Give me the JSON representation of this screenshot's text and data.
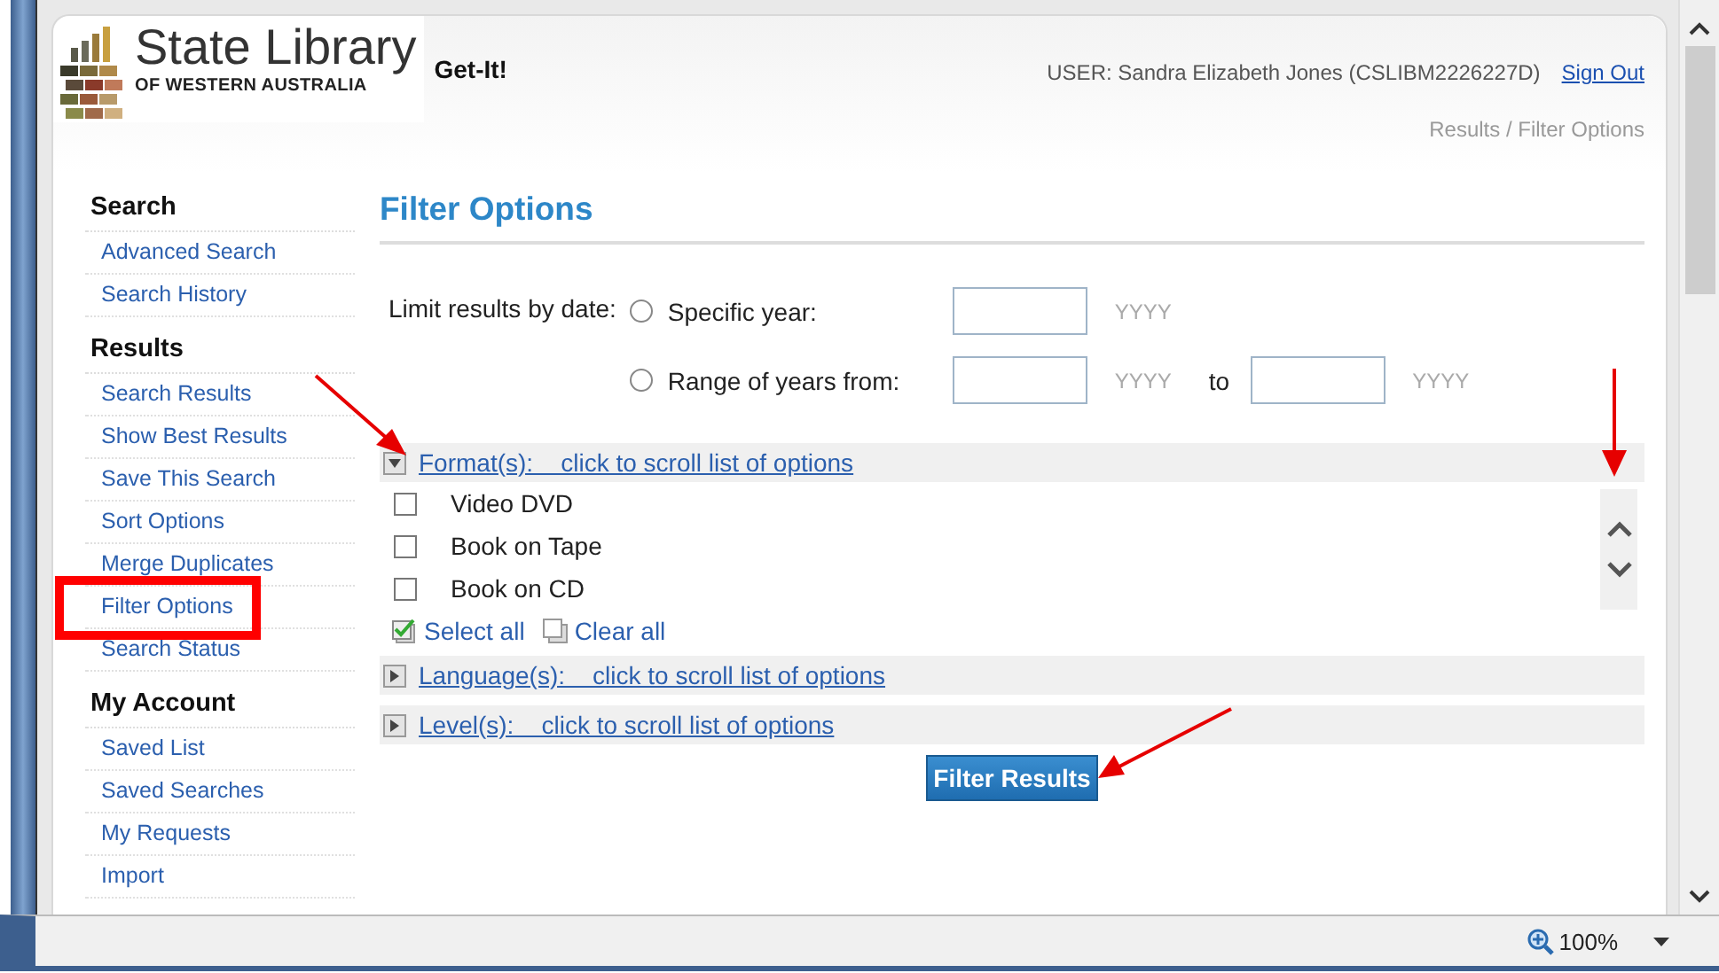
{
  "header": {
    "logo": {
      "title": "State Library",
      "subtitle": "OF WESTERN AUSTRALIA"
    },
    "app_name": "Get-It!",
    "user": "USER: Sandra Elizabeth Jones (CSLIBM2226227D)",
    "sign_out": "Sign Out",
    "breadcrumb": "Results / Filter Options"
  },
  "sidebar": {
    "sections": [
      {
        "heading": "Search",
        "items": [
          "Advanced Search",
          "Search History"
        ]
      },
      {
        "heading": "Results",
        "items": [
          "Search Results",
          "Show Best Results",
          "Save This Search",
          "Sort Options",
          "Merge Duplicates",
          "Filter Options",
          "Search Status"
        ]
      },
      {
        "heading": "My Account",
        "items": [
          "Saved List",
          "Saved Searches",
          "My Requests",
          "Import"
        ]
      }
    ]
  },
  "main": {
    "title": "Filter Options",
    "date_filter": {
      "label": "Limit results by date:",
      "options": [
        {
          "label": "Specific year:",
          "selected": false,
          "fields": [
            {
              "hint": "YYYY"
            }
          ]
        },
        {
          "label": "Range of years from:",
          "selected": false,
          "fields": [
            {
              "hint": "YYYY"
            },
            {
              "joiner": "to",
              "hint": "YYYY"
            }
          ]
        }
      ]
    },
    "facets": [
      {
        "label": "Format(s):",
        "link": "click to scroll list of options",
        "expanded": true,
        "options": [
          {
            "label": "Video DVD",
            "checked": false
          },
          {
            "label": "Book on Tape",
            "checked": false
          },
          {
            "label": "Book on CD",
            "checked": false
          }
        ],
        "select_all": "Select all",
        "clear_all": "Clear all"
      },
      {
        "label": "Language(s):",
        "link": "click to scroll list of options",
        "expanded": false
      },
      {
        "label": "Level(s):",
        "link": "click to scroll list of options",
        "expanded": false
      }
    ],
    "button": "Filter Results"
  },
  "status_bar": {
    "zoom": "100%"
  }
}
